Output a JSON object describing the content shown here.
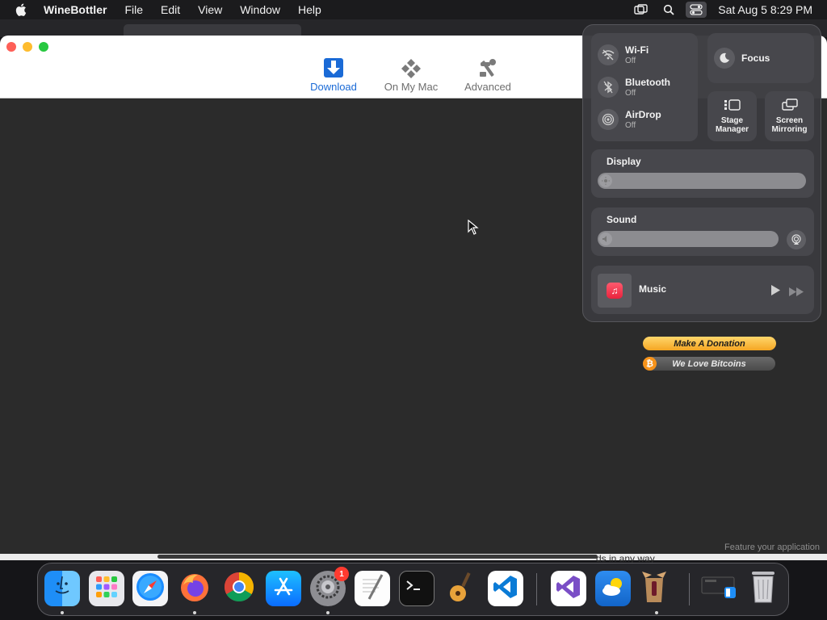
{
  "menubar": {
    "app_name": "WineBottler",
    "items": [
      "File",
      "Edit",
      "View",
      "Window",
      "Help"
    ],
    "clock": "Sat Aug 5  8:29 PM",
    "icons": [
      "display-mirror-icon",
      "search-icon",
      "control-center-icon"
    ]
  },
  "window": {
    "toolbar_tabs": [
      {
        "label": "Download",
        "icon": "download-arrow-icon",
        "selected": true
      },
      {
        "label": "On My Mac",
        "icon": "diamond-grid-icon",
        "selected": false
      },
      {
        "label": "Advanced",
        "icon": "tools-icon",
        "selected": false
      }
    ],
    "donate_label": "Make A Donation",
    "bitcoin_label": "We Love Bitcoins",
    "feature_text": "Feature your application",
    "peek_text": "ds in any way"
  },
  "control_center": {
    "wifi": {
      "label": "Wi-Fi",
      "status": "Off"
    },
    "bluetooth": {
      "label": "Bluetooth",
      "status": "Off"
    },
    "airdrop": {
      "label": "AirDrop",
      "status": "Off"
    },
    "focus": {
      "label": "Focus"
    },
    "stage_manager": {
      "line1": "Stage",
      "line2": "Manager"
    },
    "screen_mirroring": {
      "line1": "Screen",
      "line2": "Mirroring"
    },
    "display": {
      "label": "Display",
      "level": 0.05
    },
    "sound": {
      "label": "Sound",
      "level": 0.05
    },
    "music": {
      "label": "Music"
    }
  },
  "dock": {
    "apps": [
      {
        "name": "Finder",
        "running": true
      },
      {
        "name": "Launchpad",
        "running": false
      },
      {
        "name": "Safari",
        "running": false
      },
      {
        "name": "Firefox",
        "running": true
      },
      {
        "name": "Chrome",
        "running": false
      },
      {
        "name": "App Store",
        "running": false
      },
      {
        "name": "System Settings",
        "running": true,
        "badge": "1"
      },
      {
        "name": "TextEdit",
        "running": false
      },
      {
        "name": "Terminal",
        "running": false
      },
      {
        "name": "GarageBand",
        "running": false
      },
      {
        "name": "Visual Studio Code",
        "running": false
      },
      {
        "name": "Visual Studio",
        "running": false
      },
      {
        "name": "Weather",
        "running": false
      },
      {
        "name": "WineBottler",
        "running": true
      },
      {
        "name": "Downloads",
        "running": false
      },
      {
        "name": "Trash",
        "running": false
      }
    ]
  },
  "colors": {
    "accent": "#1a6ad6",
    "donate": "#f5a623",
    "bitcoin": "#f7931a"
  }
}
